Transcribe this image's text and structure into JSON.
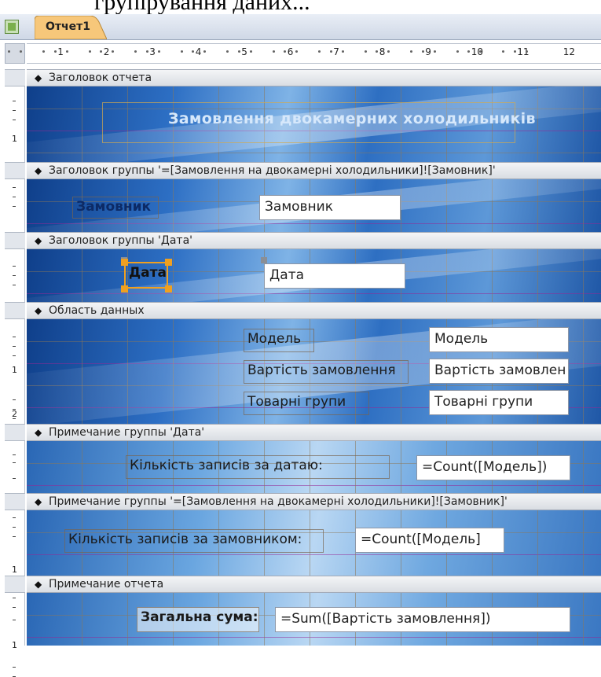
{
  "header_text": "групірування даних...",
  "tab": {
    "label": "Отчет1"
  },
  "ruler": {
    "labels": [
      "1",
      "2",
      "3",
      "4",
      "5",
      "6",
      "7",
      "8",
      "9",
      "10",
      "11",
      "12"
    ],
    "vlabels": [
      "1",
      "1",
      "2",
      "1",
      "1"
    ]
  },
  "sections": {
    "report_header": "Заголовок отчета",
    "group_customer_header": "Заголовок группы '=[Замовлення на двокамерні холодильники]![Замовник]'",
    "group_date_header": "Заголовок группы 'Дата'",
    "detail": "Область данных",
    "group_date_footer": "Примечание группы 'Дата'",
    "group_customer_footer": "Примечание группы '=[Замовлення на двокамерні холодильники]![Замовник]'",
    "report_footer": "Примечание отчета"
  },
  "report_title": "Замовлення двокамерних холодильників",
  "customer": {
    "label": "Замовник",
    "field": "Замовник"
  },
  "date": {
    "label": "Дата",
    "field": "Дата"
  },
  "detail": {
    "model_label": "Модель",
    "model_field": "Модель",
    "cost_label": "Вартість замовлення",
    "cost_field": "Вартість замовлен",
    "group_label": "Товарні групи",
    "group_field": "Товарні групи"
  },
  "date_footer": {
    "label": "Кількість записів за датаю:",
    "field": "=Count([Модель])"
  },
  "customer_footer": {
    "label": "Кількість записів за замовником:",
    "field": "=Count([Модель]"
  },
  "report_footer": {
    "label": "Загальна сума:",
    "field": "=Sum([Вартість замовлення])"
  }
}
